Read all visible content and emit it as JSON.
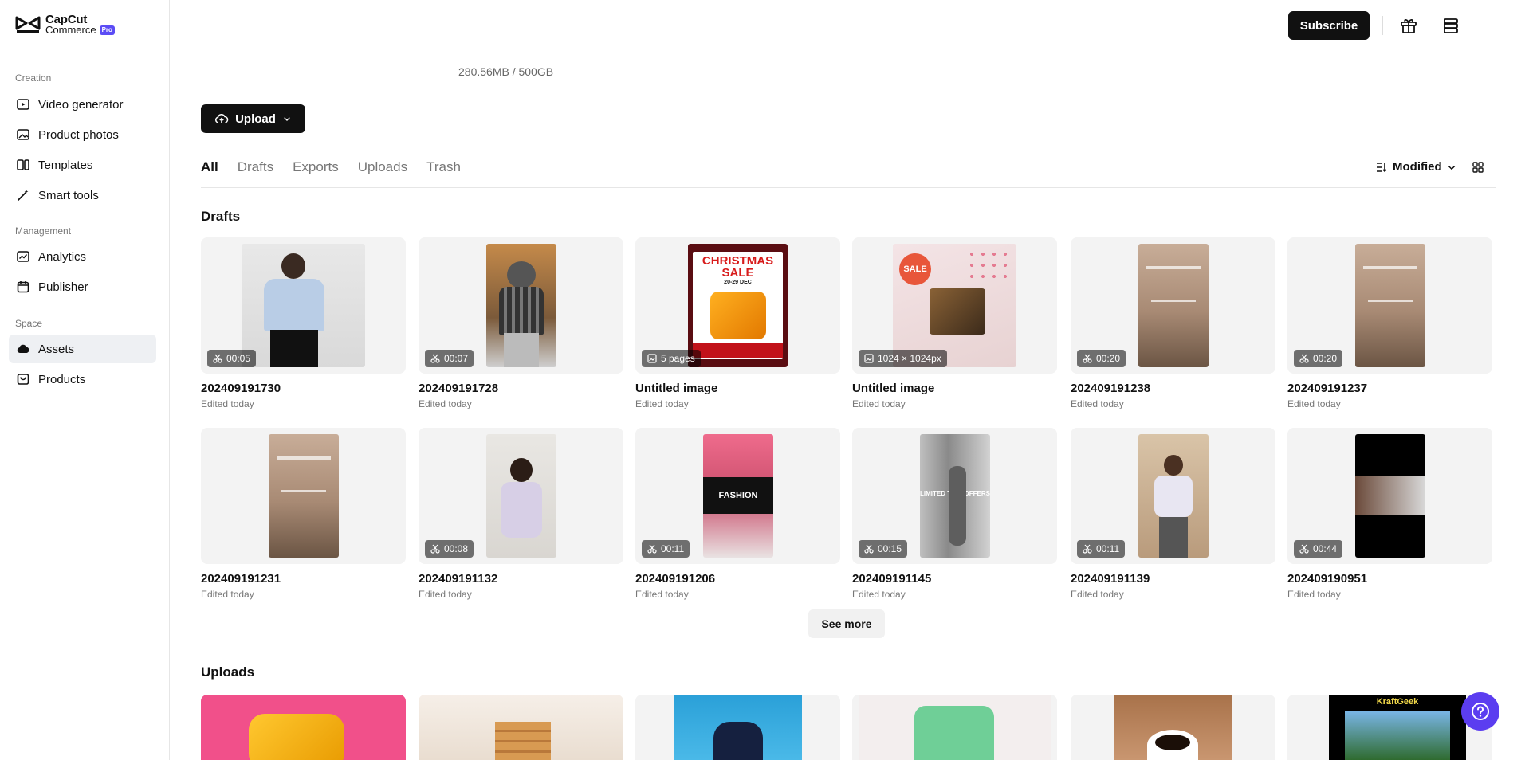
{
  "brand": {
    "line1": "CapCut",
    "line2": "Commerce",
    "badge": "Pro"
  },
  "sidebar": {
    "sections": [
      {
        "label": "Creation",
        "items": [
          {
            "label": "Video generator",
            "icon": "video-generator-icon"
          },
          {
            "label": "Product photos",
            "icon": "image-icon"
          },
          {
            "label": "Templates",
            "icon": "templates-icon"
          },
          {
            "label": "Smart tools",
            "icon": "magic-wand-icon"
          }
        ]
      },
      {
        "label": "Management",
        "items": [
          {
            "label": "Analytics",
            "icon": "analytics-icon"
          },
          {
            "label": "Publisher",
            "icon": "calendar-icon"
          }
        ]
      },
      {
        "label": "Space",
        "items": [
          {
            "label": "Assets",
            "icon": "cloud-icon",
            "active": true
          },
          {
            "label": "Products",
            "icon": "products-icon"
          }
        ]
      }
    ]
  },
  "header": {
    "subscribe_label": "Subscribe"
  },
  "storage": "280.56MB / 500GB",
  "upload": {
    "label": "Upload"
  },
  "tabs": [
    "All",
    "Drafts",
    "Exports",
    "Uploads",
    "Trash"
  ],
  "sort": {
    "label": "Modified"
  },
  "drafts": {
    "title": "Drafts",
    "items": [
      {
        "name": "202409191730",
        "sub": "Edited today",
        "badge": "00:05",
        "kind": "video"
      },
      {
        "name": "202409191728",
        "sub": "Edited today",
        "badge": "00:07",
        "kind": "video"
      },
      {
        "name": "Untitled image",
        "sub": "Edited today",
        "badge": "5 pages",
        "kind": "image"
      },
      {
        "name": "Untitled image",
        "sub": "Edited today",
        "badge": "1024 × 1024px",
        "kind": "image"
      },
      {
        "name": "202409191238",
        "sub": "Edited today",
        "badge": "00:20",
        "kind": "video"
      },
      {
        "name": "202409191237",
        "sub": "Edited today",
        "badge": "00:20",
        "kind": "video"
      },
      {
        "name": "202409191231",
        "sub": "Edited today",
        "badge": "",
        "kind": "video"
      },
      {
        "name": "202409191132",
        "sub": "Edited today",
        "badge": "00:08",
        "kind": "video"
      },
      {
        "name": "202409191206",
        "sub": "Edited today",
        "badge": "00:11",
        "kind": "video"
      },
      {
        "name": "202409191145",
        "sub": "Edited today",
        "badge": "00:15",
        "kind": "video"
      },
      {
        "name": "202409191139",
        "sub": "Edited today",
        "badge": "00:11",
        "kind": "video"
      },
      {
        "name": "202409190951",
        "sub": "Edited today",
        "badge": "00:44",
        "kind": "video"
      }
    ],
    "see_more": "See more"
  },
  "thumb_text": {
    "christmas_line1": "CHRISTMAS",
    "christmas_line2": "SALE",
    "christmas_date": "20-29 DEC",
    "sale_sticker": "SALE",
    "fashion": "FASHION",
    "offer": "LIMITED TIME OFFERS",
    "upload_brand": "KraftGeek"
  },
  "uploads": {
    "title": "Uploads"
  },
  "colors": {
    "accent": "#5b3df0",
    "dark": "#111111"
  }
}
